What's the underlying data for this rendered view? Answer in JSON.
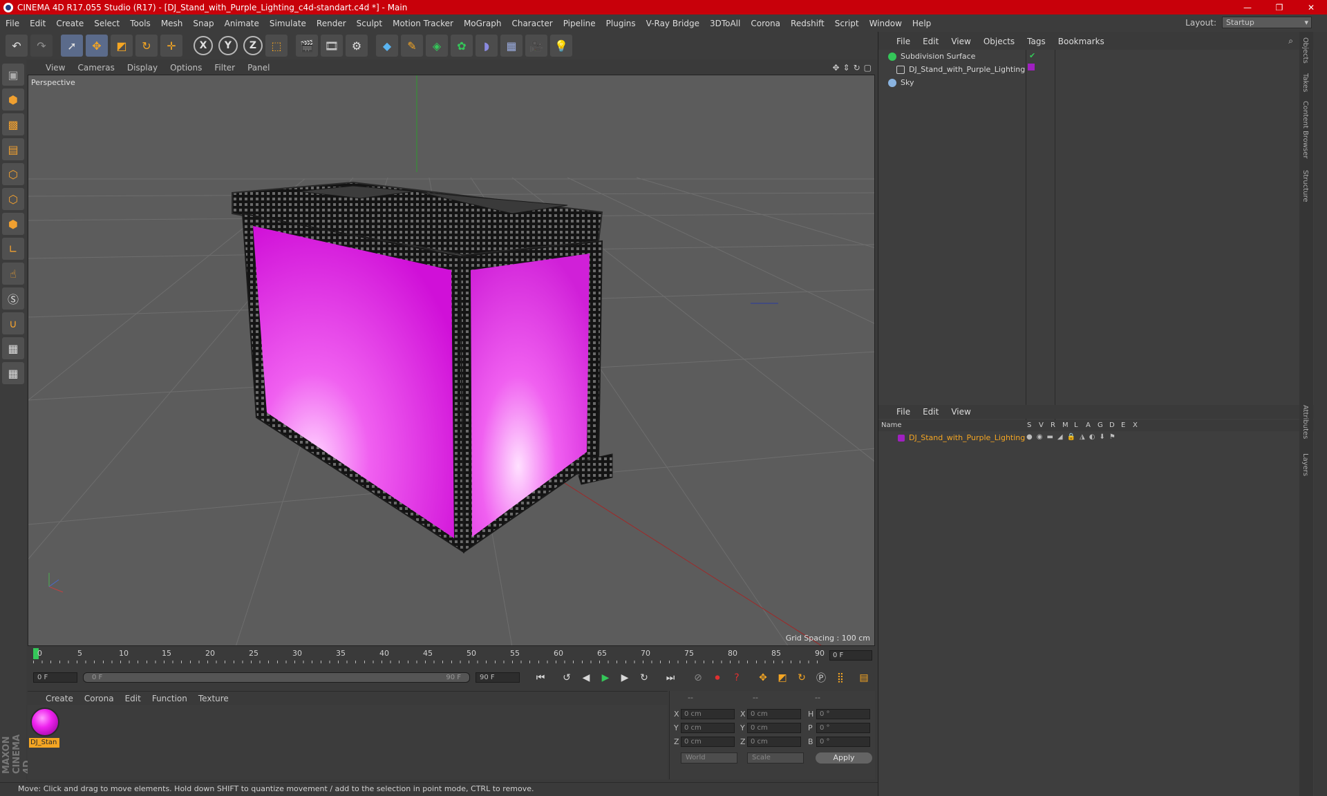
{
  "window": {
    "title": "CINEMA 4D R17.055 Studio (R17) - [DJ_Stand_with_Purple_Lighting_c4d-standart.c4d *] - Main",
    "controls": [
      "—",
      "❐",
      "✕"
    ]
  },
  "menu": [
    "File",
    "Edit",
    "Create",
    "Select",
    "Tools",
    "Mesh",
    "Snap",
    "Animate",
    "Simulate",
    "Render",
    "Sculpt",
    "Motion Tracker",
    "MoGraph",
    "Character",
    "Pipeline",
    "Plugins",
    "V-Ray Bridge",
    "3DToAll",
    "Corona",
    "Redshift",
    "Script",
    "Window",
    "Help"
  ],
  "layout": {
    "label": "Layout:",
    "value": "Startup"
  },
  "toolbar": {
    "undo_icon": "undo-icon",
    "redo_icon": "redo-icon",
    "axis_x": "X",
    "axis_y": "Y",
    "axis_z": "Z"
  },
  "viewport": {
    "menu": [
      "View",
      "Cameras",
      "Display",
      "Options",
      "Filter",
      "Panel"
    ],
    "label": "Perspective",
    "grid_spacing": "Grid Spacing : 100 cm"
  },
  "timeline": {
    "ticks": [
      "0",
      "5",
      "10",
      "15",
      "20",
      "25",
      "30",
      "35",
      "40",
      "45",
      "50",
      "55",
      "60",
      "65",
      "70",
      "75",
      "80",
      "85",
      "90"
    ],
    "current_frame": "0 F",
    "start_field": "0 F",
    "range_start": "0 F",
    "range_end": "90 F",
    "end_field": "90 F"
  },
  "materials": {
    "menu": [
      "Create",
      "Corona",
      "Edit",
      "Function",
      "Texture"
    ],
    "items": [
      {
        "name": "DJ_Stan",
        "color": "#e020e0"
      }
    ]
  },
  "coordinates": {
    "header": [
      "--",
      "--",
      "--"
    ],
    "rows": [
      {
        "a1": "X",
        "v1": "0 cm",
        "a2": "X",
        "v2": "0 cm",
        "a3": "H",
        "v3": "0 °"
      },
      {
        "a1": "Y",
        "v1": "0 cm",
        "a2": "Y",
        "v2": "0 cm",
        "a3": "P",
        "v3": "0 °"
      },
      {
        "a1": "Z",
        "v1": "0 cm",
        "a2": "Z",
        "v2": "0 cm",
        "a3": "B",
        "v3": "0 °"
      }
    ],
    "world": "World",
    "scale": "Scale",
    "apply": "Apply"
  },
  "status": "Move: Click and drag to move elements. Hold down SHIFT to quantize movement / add to the selection in point mode, CTRL to remove.",
  "object_manager": {
    "menu": [
      "File",
      "Edit",
      "View",
      "Objects",
      "Tags",
      "Bookmarks"
    ],
    "objects": [
      {
        "name": "Subdivision Surface",
        "color": "#34c759"
      },
      {
        "name": "DJ_Stand_with_Purple_Lighting",
        "color": "#c8c8c8"
      },
      {
        "name": "Sky",
        "color": "#8ab4e0"
      }
    ]
  },
  "layer_manager": {
    "menu": [
      "File",
      "Edit",
      "View"
    ],
    "columns": [
      "Name",
      "S",
      "V",
      "R",
      "M",
      "L",
      "A",
      "G",
      "D",
      "E",
      "X"
    ],
    "layers": [
      {
        "name": "DJ_Stand_with_Purple_Lighting",
        "color": "#f5a623"
      }
    ]
  },
  "side_tabs": [
    "Objects",
    "Takes",
    "Content Browser",
    "Structure",
    "Attributes",
    "Layers"
  ],
  "maxon": "MAXON CINEMA 4D"
}
